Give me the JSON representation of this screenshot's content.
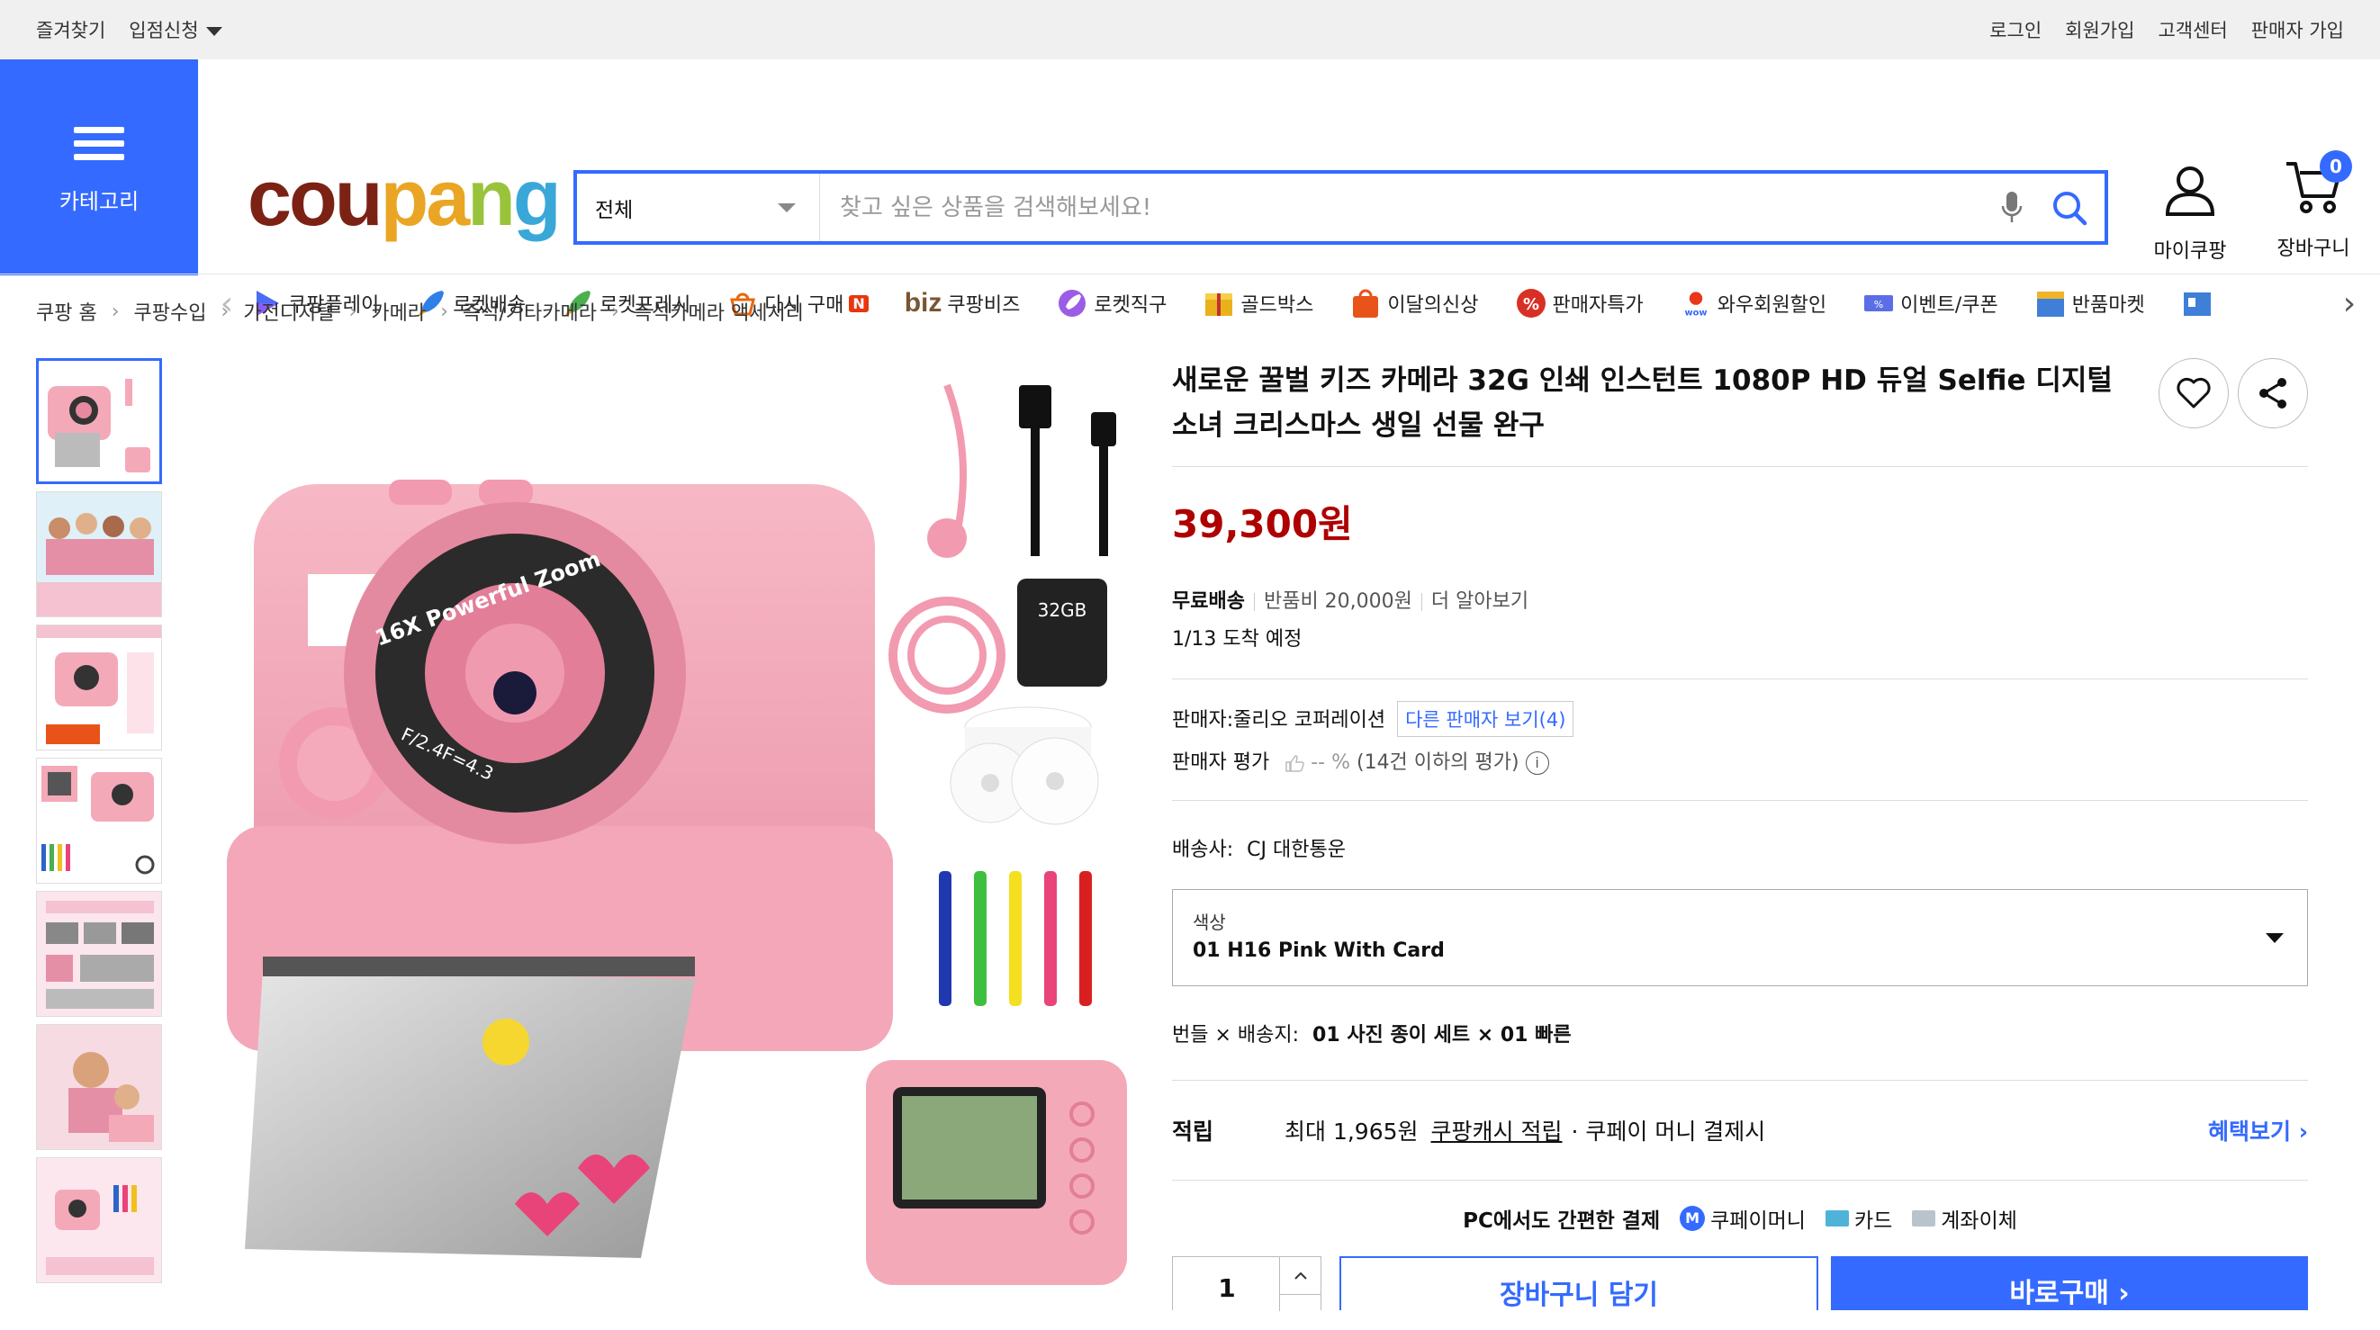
{
  "topbar": {
    "bookmark": "즐겨찾기",
    "apply": "입점신청",
    "login": "로그인",
    "signup": "회원가입",
    "support": "고객센터",
    "seller_join": "판매자 가입"
  },
  "header": {
    "category_label": "카테고리",
    "logo": {
      "p1": "cou",
      "p2": "pa",
      "p3": "n",
      "p4": "g"
    },
    "search": {
      "scope": "전체",
      "placeholder": "찾고 싶은 상품을 검색해보세요!"
    },
    "my_coupang": "마이쿠팡",
    "cart_label": "장바구니",
    "cart_count": "0"
  },
  "nav": {
    "items": [
      {
        "label": "쿠팡플레이",
        "icon": "play-icon"
      },
      {
        "label": "로켓배송",
        "icon": "rocket-icon"
      },
      {
        "label": "로켓프레시",
        "icon": "rocket-fresh-icon"
      },
      {
        "label": "다시 구매",
        "icon": "rebuy-icon"
      },
      {
        "label": "쿠팡비즈",
        "icon": "biz-icon"
      },
      {
        "label": "로켓직구",
        "icon": "global-rocket-icon"
      },
      {
        "label": "골드박스",
        "icon": "goldbox-icon"
      },
      {
        "label": "이달의신상",
        "icon": "new-bag-icon"
      },
      {
        "label": "판매자특가",
        "icon": "percent-icon"
      },
      {
        "label": "와우회원할인",
        "icon": "wow-icon"
      },
      {
        "label": "이벤트/쿠폰",
        "icon": "coupon-icon"
      },
      {
        "label": "반품마켓",
        "icon": "return-market-icon"
      }
    ],
    "biz_prefix": "biz",
    "rebuy_badge": "N"
  },
  "breadcrumb": [
    "쿠팡 홈",
    "쿠팡수입",
    "가전디지털",
    "카메라",
    "즉석/기타카메라",
    "즉석카메라 액세서리"
  ],
  "product": {
    "title": "새로운 꿀벌 키즈 카메라 32G 인쇄 인스턴트 1080P HD 듀얼 Selfie 디지털 소녀 크리스마스 생일 선물 완구",
    "price": "39,300원",
    "shipping": {
      "free": "무료배송",
      "return_fee": "반품비 20,000원",
      "more": "더 알아보기",
      "arrival": "1/13 도착 예정"
    },
    "seller": {
      "label": "판매자:",
      "name": "줄리오 코퍼레이션",
      "other_link": "다른 판매자 보기(4)",
      "rating_label": "판매자 평가",
      "rating": "-- %",
      "rating_note": "(14건 이하의 평가)"
    },
    "carrier": {
      "label": "배송사:",
      "name": "CJ 대한통운"
    },
    "option": {
      "label": "색상",
      "value": "01 H16 Pink With Card"
    },
    "bundle": {
      "label": "번들 × 배송지:",
      "value": "01 사진 종이 세트 × 01 빠른"
    },
    "reward": {
      "heading": "적립",
      "max": "최대 1,965원",
      "link": "쿠팡캐시 적립",
      "note": "· 쿠페이 머니 결제시",
      "benefit": "혜택보기 ›"
    },
    "pay": {
      "title": "PC에서도 간편한 결제",
      "m1": "쿠페이머니",
      "m2": "카드",
      "m3": "계좌이체"
    },
    "qty": "1",
    "cart_btn": "장바구니 담기",
    "buy_btn": "바로구매 ›"
  },
  "camera": {
    "lens_text": "16X Powerful Zoom",
    "aperture": "F/2.4F=4.3",
    "sd_label": "32GB"
  },
  "colors": {
    "accent": "#346aff",
    "price": "#ae0000",
    "pink": "#f4a9b9"
  }
}
